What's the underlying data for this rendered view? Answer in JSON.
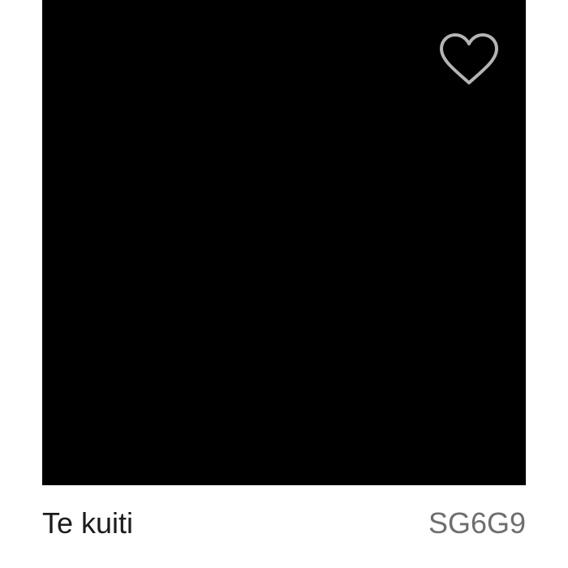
{
  "swatch": {
    "color": "#000000"
  },
  "favorite": {
    "icon": "heart-outline-icon",
    "icon_color": "#b4b4b4"
  },
  "caption": {
    "name": "Te kuiti",
    "code": "SG6G9"
  }
}
